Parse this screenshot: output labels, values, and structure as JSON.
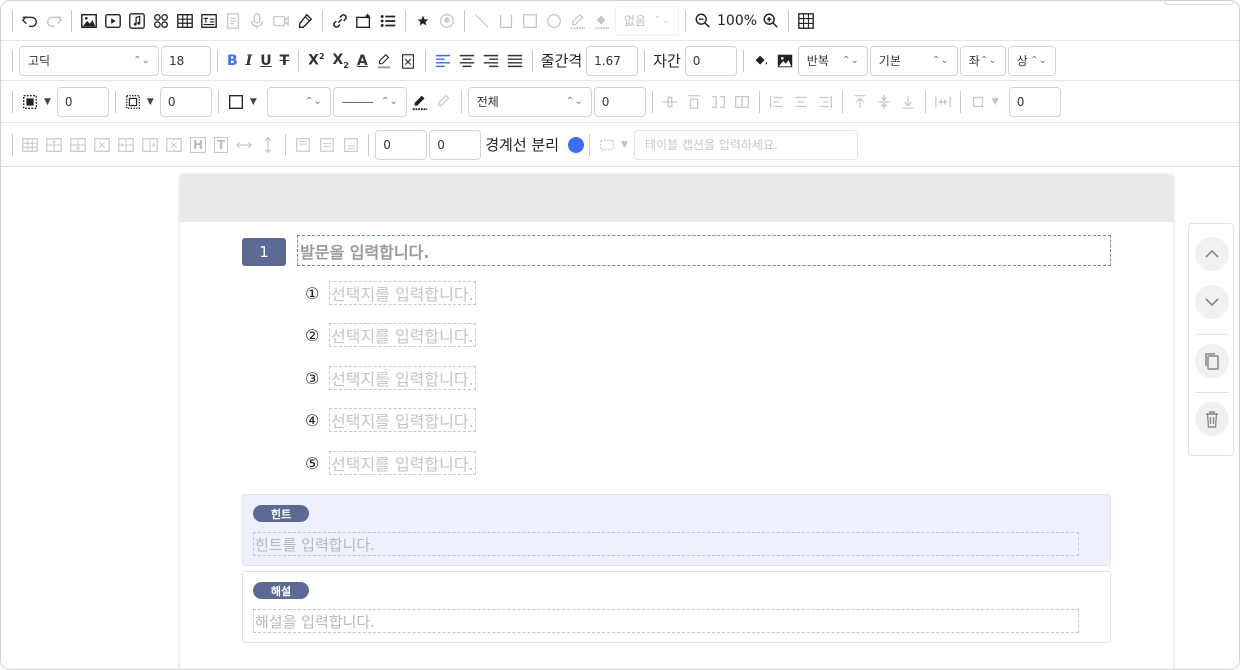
{
  "toolbar": {
    "shape_select": "없음",
    "zoom_level": "100%",
    "font_family": "고딕",
    "font_size": "18",
    "line_spacing_label": "줄간격",
    "line_spacing_value": "1.67",
    "letter_spacing_label": "자간",
    "letter_spacing_value": "0",
    "bg_repeat": "반복",
    "bg_size": "기본",
    "bg_pos_x": "좌",
    "bg_pos_y": "상",
    "border_width": "0",
    "padding_value": "0",
    "border_line_style": "———",
    "apply_target": "전체",
    "apply_value": "0",
    "cell_value": "0",
    "table_width": "0",
    "table_height": "0",
    "border_separate_label": "경계선 분리",
    "caption_placeholder": "테이블 캡션을 입력하세요.",
    "bold": "B",
    "italic": "I",
    "underline": "U",
    "strike": "T",
    "superscript": "X",
    "subscript": "X",
    "font_color": "A",
    "heading_btn": "H",
    "text_btn": "T"
  },
  "question": {
    "number": "1",
    "prompt_placeholder": "발문을 입력합니다.",
    "choices": [
      {
        "marker": "①",
        "placeholder": "선택지를 입력합니다."
      },
      {
        "marker": "②",
        "placeholder": "선택지를 입력합니다."
      },
      {
        "marker": "③",
        "placeholder": "선택지를 입력합니다."
      },
      {
        "marker": "④",
        "placeholder": "선택지를 입력합니다."
      },
      {
        "marker": "⑤",
        "placeholder": "선택지를 입력합니다."
      }
    ],
    "hint_label": "힌트",
    "hint_placeholder": "힌트를 입력합니다.",
    "explanation_label": "해설",
    "explanation_placeholder": "해설을 입력합니다."
  },
  "colors": {
    "accent": "#5c6994",
    "toggle": "#3f6df5",
    "hint_bg": "#eef1fd"
  },
  "icons": [
    "undo-icon",
    "redo-icon",
    "image-icon",
    "video-icon",
    "audio-icon",
    "formula-icon",
    "table-icon",
    "textbox-icon",
    "chevron-up-icon",
    "chevron-down-icon",
    "copy-icon",
    "trash-icon"
  ]
}
